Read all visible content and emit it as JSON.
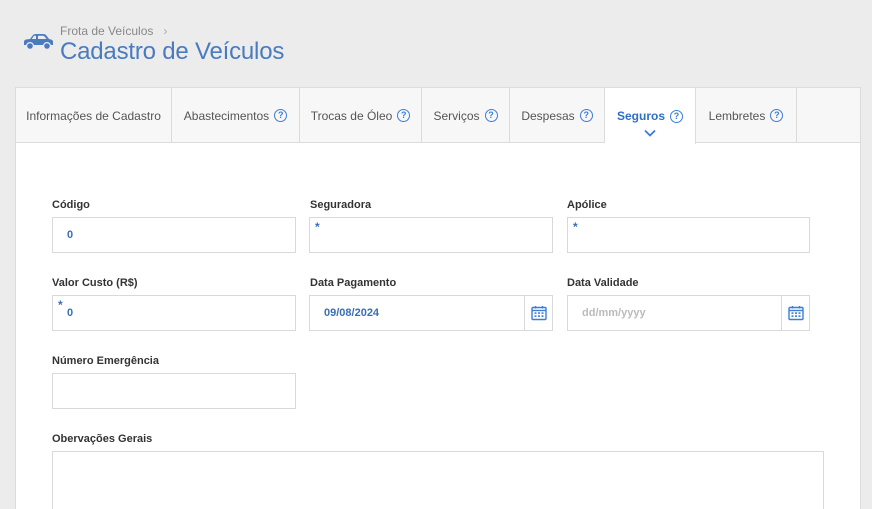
{
  "header": {
    "breadcrumb": "Frota de Veículos",
    "title": "Cadastro de Veículos"
  },
  "tabs": [
    {
      "label": "Informações de Cadastro",
      "help": false
    },
    {
      "label": "Abastecimentos",
      "help": true
    },
    {
      "label": "Trocas de Óleo",
      "help": true
    },
    {
      "label": "Serviços",
      "help": true
    },
    {
      "label": "Despesas",
      "help": true
    },
    {
      "label": "Seguros",
      "help": true,
      "active": true
    },
    {
      "label": "Lembretes",
      "help": true
    }
  ],
  "form": {
    "codigo": {
      "label": "Código",
      "value": "0"
    },
    "seguradora": {
      "label": "Seguradora",
      "value": "",
      "required_mark": "*"
    },
    "apolice": {
      "label": "Apólice",
      "value": "",
      "required_mark": "*"
    },
    "valor_custo": {
      "label": "Valor Custo (R$)",
      "value": "0",
      "required_mark": "*"
    },
    "data_pagamento": {
      "label": "Data Pagamento",
      "value": "09/08/2024"
    },
    "data_validade": {
      "label": "Data Validade",
      "placeholder": "dd/mm/yyyy"
    },
    "numero_emergencia": {
      "label": "Número Emergência",
      "value": ""
    },
    "observacoes": {
      "label": "Obervações Gerais",
      "value": ""
    }
  },
  "colors": {
    "accent": "#3b7dd8",
    "title": "#4a7bbf"
  }
}
